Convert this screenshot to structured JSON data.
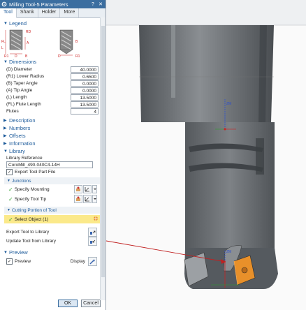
{
  "window": {
    "title": "Milling Tool-5 Parameters",
    "help": "?",
    "close": "✕"
  },
  "tabs": [
    {
      "label": "Tool"
    },
    {
      "label": "Shank"
    },
    {
      "label": "Holder"
    },
    {
      "label": "More"
    }
  ],
  "legend": {
    "title": "Legend",
    "labels": [
      "RD",
      "FL",
      "A",
      "L",
      "D",
      "R1",
      "B",
      "D",
      "R1",
      "B"
    ]
  },
  "dimensions": {
    "title": "Dimensions",
    "fields": [
      {
        "label": "(D) Diameter",
        "value": "40.0000"
      },
      {
        "label": "(R1) Lower Radius",
        "value": "0.6500"
      },
      {
        "label": "(B) Taper Angle",
        "value": "0.0000"
      },
      {
        "label": "(A) Tip Angle",
        "value": "0.0000"
      },
      {
        "label": "(L) Length",
        "value": "13.5000"
      },
      {
        "label": "(FL) Flute Length",
        "value": "13.5000"
      },
      {
        "label": "Flutes",
        "value": "4"
      }
    ]
  },
  "collapsed_sections": [
    "Description",
    "Numbers",
    "Offsets",
    "Information"
  ],
  "library": {
    "title": "Library",
    "reference_label": "Library Reference",
    "reference_value": "CoroMill_490-040C4-14H",
    "export_part_file": "Export Tool Part File",
    "junctions_title": "Junctions",
    "specify_mounting": "Specify Mounting",
    "specify_tool_tip": "Specify Tool Tip",
    "cutting_title": "Cutting Portion of Tool",
    "select_object": "Select Object (1)",
    "export_tool": "Export Tool to Library",
    "update_tool": "Update Tool from Library"
  },
  "preview": {
    "title": "Preview",
    "preview_label": "Preview",
    "display_label": "Display"
  },
  "footer": {
    "ok": "OK",
    "cancel": "Cancel"
  },
  "viewport": {
    "axis_z": "ZM",
    "axis_z2": "ZM"
  },
  "colors": {
    "title_bar": "#3b6ea0",
    "accent": "#1c5a9a",
    "selection": "#fbe98a",
    "insert": "#e8902a",
    "tool_body": "#6b6f73"
  }
}
